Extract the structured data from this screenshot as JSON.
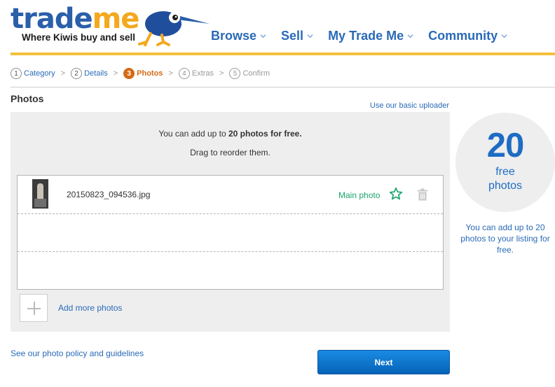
{
  "header": {
    "logo_word_1": "trade",
    "logo_word_2": "me",
    "logo_tagline": "Where Kiwis buy and sell",
    "nav": [
      {
        "label": "Browse"
      },
      {
        "label": "Sell"
      },
      {
        "label": "My Trade Me"
      },
      {
        "label": "Community"
      }
    ]
  },
  "steps": [
    {
      "num": "1",
      "label": "Category",
      "state": "done"
    },
    {
      "num": "2",
      "label": "Details",
      "state": "done"
    },
    {
      "num": "3",
      "label": "Photos",
      "state": "active"
    },
    {
      "num": "4",
      "label": "Extras",
      "state": "future"
    },
    {
      "num": "5",
      "label": "Confirm",
      "state": "future"
    }
  ],
  "step_separator": ">",
  "photos": {
    "title": "Photos",
    "basic_uploader_link": "Use our basic uploader",
    "intro_prefix": "You can add up to ",
    "intro_bold": "20 photos for free.",
    "drag_text": "Drag to reorder them.",
    "items": [
      {
        "filename": "20150823_094536.jpg",
        "main_label": "Main photo"
      }
    ],
    "add_more_label": "Add more photos",
    "policy_link": "See our photo policy and guidelines",
    "next_label": "Next"
  },
  "promo": {
    "count": "20",
    "line1": "free",
    "line2": "photos",
    "text": "You can add up to 20 photos to your listing for free."
  },
  "colors": {
    "brand_blue": "#2a6ab7",
    "brand_yellow": "#f4c03c",
    "active_step": "#d46a17",
    "main_photo_green": "#1aa56b",
    "button_blue": "#0a72d0"
  },
  "icons": [
    "kiwi-logo",
    "chevron-down-icon",
    "star-icon",
    "trash-icon",
    "plus-icon"
  ]
}
